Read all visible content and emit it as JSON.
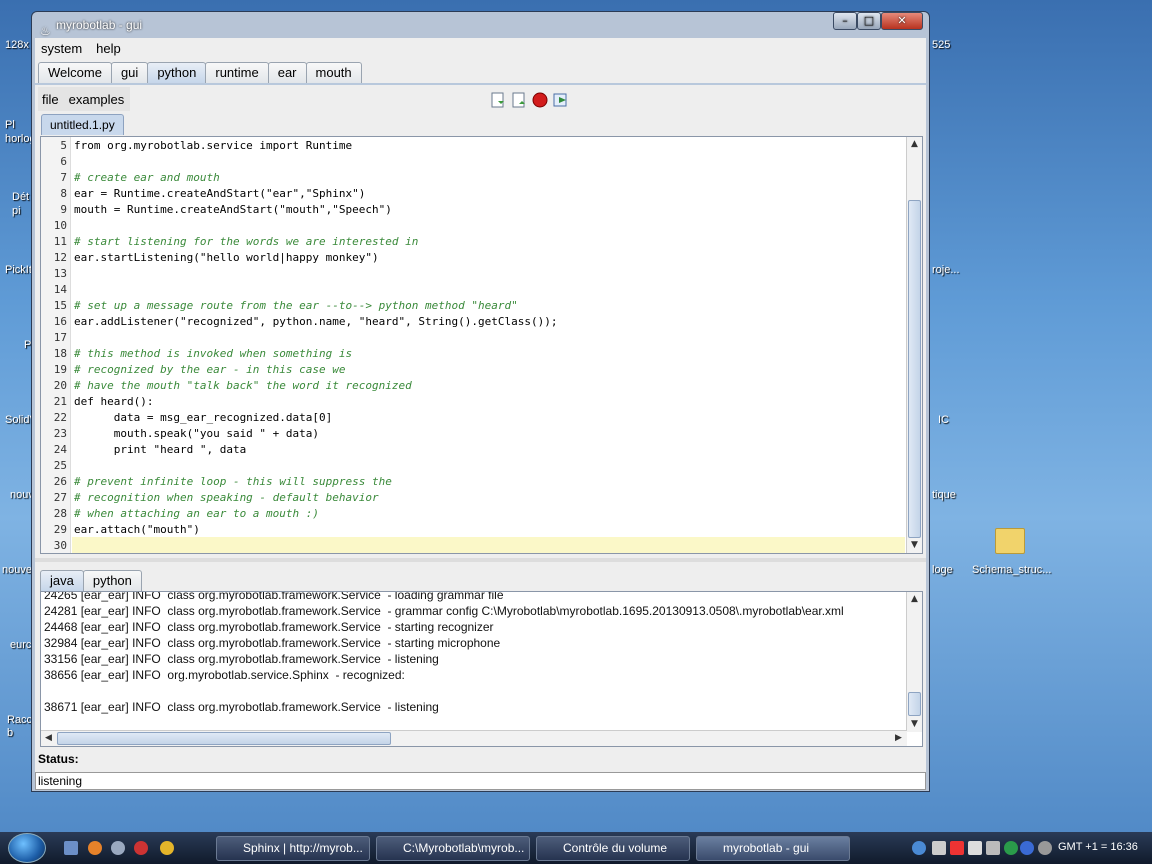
{
  "desktop": {
    "labels": [
      "128x",
      "Pl horloge",
      "Dét pi",
      "PickIt",
      "P",
      "SolidV",
      "nouve",
      "nouve",
      "eurc",
      "Racc b"
    ],
    "right_labels": [
      "525",
      "roje...",
      "IC",
      "tique",
      "loge"
    ],
    "folder": "Schema_struc..."
  },
  "window": {
    "title": "myrobotlab - gui",
    "min": "–",
    "max": "□",
    "close": "✕"
  },
  "menu": {
    "system": "system",
    "help": "help"
  },
  "tabs": [
    "Welcome",
    "gui",
    "python",
    "runtime",
    "ear",
    "mouth"
  ],
  "active_tab": "python",
  "subbar": {
    "file": "file",
    "examples": "examples"
  },
  "toolbar": {
    "new": "new-file-icon",
    "open": "open-file-icon",
    "stop": "stop-icon",
    "run": "run-icon"
  },
  "file_tab": "untitled.1.py",
  "code": {
    "line_numbers": [
      "5",
      "6",
      "7",
      "8",
      "9",
      "10",
      "11",
      "12",
      "13",
      "14",
      "15",
      "16",
      "17",
      "18",
      "19",
      "20",
      "21",
      "22",
      "23",
      "24",
      "25",
      "26",
      "27",
      "28",
      "29",
      "30"
    ],
    "lines": [
      "from org.myrobotlab.service import Runtime",
      "",
      "# create ear and mouth",
      "ear = Runtime.createAndStart(\"ear\",\"Sphinx\")",
      "mouth = Runtime.createAndStart(\"mouth\",\"Speech\")",
      "",
      "# start listening for the words we are interested in",
      "ear.startListening(\"hello world|happy monkey\")",
      "",
      "",
      "# set up a message route from the ear --to--> python method \"heard\"",
      "ear.addListener(\"recognized\", python.name, \"heard\", String().getClass());",
      "",
      "# this method is invoked when something is",
      "# recognized by the ear - in this case we",
      "# have the mouth \"talk back\" the word it recognized",
      "def heard():",
      "      data = msg_ear_recognized.data[0]",
      "      mouth.speak(\"you said \" + data)",
      "      print \"heard \", data",
      "",
      "# prevent infinite loop - this will suppress the",
      "# recognition when speaking - default behavior",
      "# when attaching an ear to a mouth :)",
      "ear.attach(\"mouth\")",
      ""
    ]
  },
  "console_tabs": [
    "java",
    "python"
  ],
  "log": [
    "24265 [ear_ear] INFO  class org.myrobotlab.framework.Service  - loading grammar file",
    "24281 [ear_ear] INFO  class org.myrobotlab.framework.Service  - grammar config C:\\Myrobotlab\\myrobotlab.1695.20130913.0508\\.myrobotlab\\ear.xml",
    "24468 [ear_ear] INFO  class org.myrobotlab.framework.Service  - starting recognizer",
    "32984 [ear_ear] INFO  class org.myrobotlab.framework.Service  - starting microphone",
    "33156 [ear_ear] INFO  class org.myrobotlab.framework.Service  - listening",
    "38656 [ear_ear] INFO  org.myrobotlab.service.Sphinx  - recognized:",
    "",
    "38671 [ear_ear] INFO  class org.myrobotlab.framework.Service  - listening"
  ],
  "status": {
    "label": "Status:",
    "value": "listening"
  },
  "taskbar": {
    "items": [
      "Sphinx | http://myrob...",
      "C:\\Myrobotlab\\myrob...",
      "Contrôle du volume",
      "myrobotlab - gui"
    ],
    "clock": "GMT +1 = 16:36"
  }
}
